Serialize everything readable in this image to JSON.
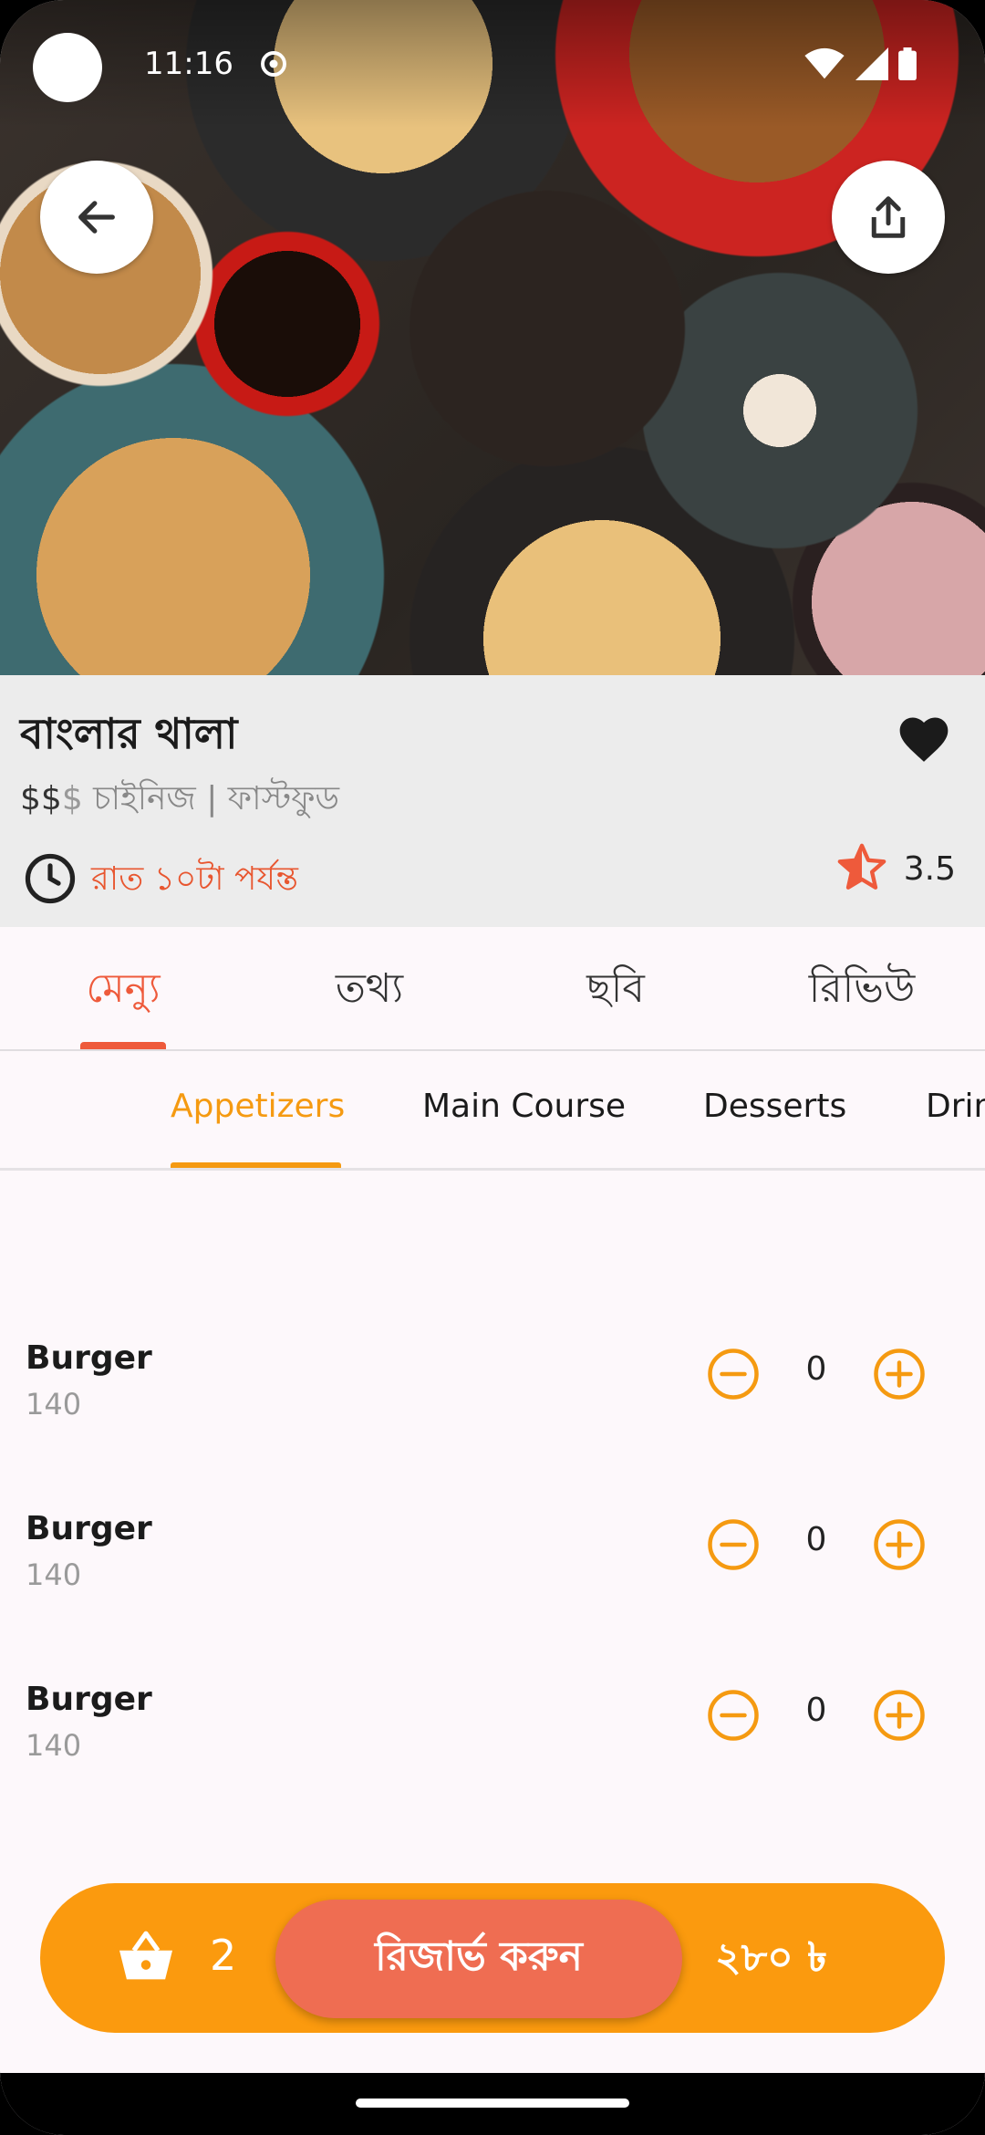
{
  "status_bar": {
    "time": "11:16"
  },
  "restaurant": {
    "name": "বাংলার থালা",
    "price_active": "$$",
    "price_inactive": "$",
    "categories": " চাইনিজ | ফাস্টফুড",
    "hours": "রাত ১০টা পর্যন্ত",
    "rating": "3.5"
  },
  "main_tabs": [
    {
      "label": "মেন্যু",
      "active": true
    },
    {
      "label": "তথ্য",
      "active": false
    },
    {
      "label": "ছবি",
      "active": false
    },
    {
      "label": "রিভিউ",
      "active": false
    }
  ],
  "menu_categories": [
    {
      "label": "Appetizers",
      "active": true
    },
    {
      "label": "Main Course",
      "active": false
    },
    {
      "label": "Desserts",
      "active": false
    },
    {
      "label": "Drinks",
      "active": false
    }
  ],
  "menu_items": [
    {
      "name": "Burger",
      "price": "140",
      "quantity": "0"
    },
    {
      "name": "Burger",
      "price": "140",
      "quantity": "0"
    },
    {
      "name": "Burger",
      "price": "140",
      "quantity": "0"
    }
  ],
  "cart": {
    "count": "2",
    "reserve_label": "রিজার্ভ করুন",
    "total": "২৮০ ৳"
  },
  "colors": {
    "accent": "#ee5a3b",
    "category_accent": "#f59a11",
    "cart_bar": "#fb9a0e",
    "reserve_button": "#ef6d52"
  },
  "icons": {
    "back": "arrow-left-icon",
    "share": "share-icon",
    "favorite": "heart-icon",
    "hours": "clock-icon",
    "rating": "star-icon",
    "decrease": "minus-circle-icon",
    "increase": "plus-circle-icon",
    "cart": "basket-icon"
  }
}
